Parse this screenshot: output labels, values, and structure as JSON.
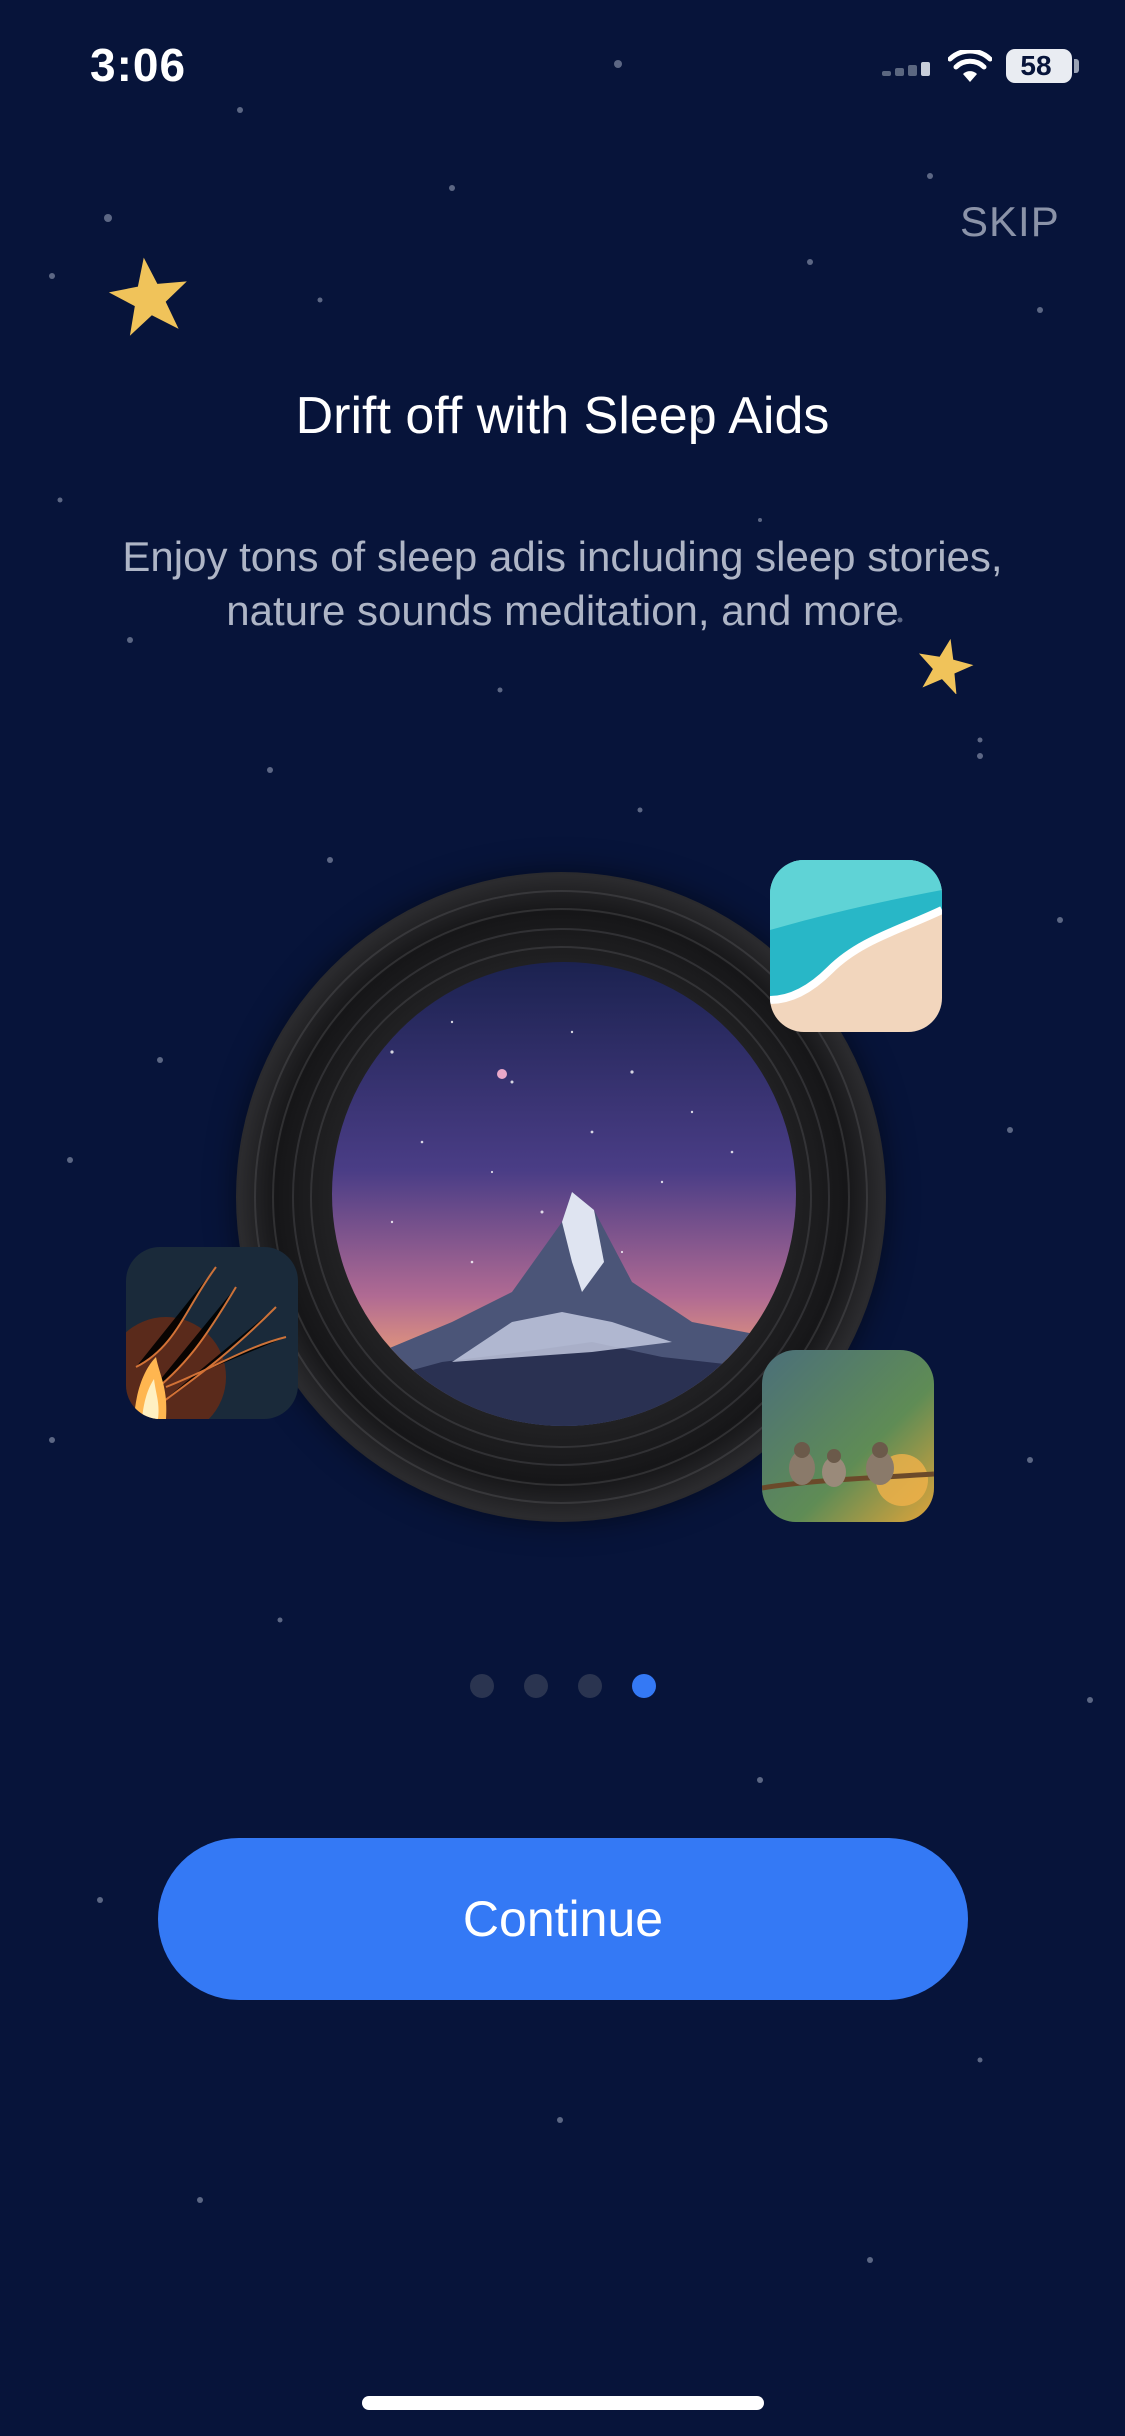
{
  "status_bar": {
    "time": "3:06",
    "battery": "58"
  },
  "onboarding": {
    "skip_label": "SKIP",
    "title": "Drift off with Sleep Aids",
    "subtitle_line1": "Enjoy tons of sleep adis including sleep stories,",
    "subtitle_line2": "nature sounds meditation, and more",
    "continue_label": "Continue",
    "pagination": {
      "total": 4,
      "active_index": 3
    }
  },
  "colors": {
    "background": "#07143a",
    "accent": "#3479f5",
    "star": "#f0c35a",
    "dot_inactive": "#2a3450",
    "subtitle": "#aeb5c6",
    "skip": "#8b93a8"
  },
  "icons": [
    "star-icon",
    "wifi-icon",
    "battery-icon",
    "signal-icon"
  ],
  "images": [
    "mountain-night-sky-image",
    "beach-wave-image",
    "campfire-image",
    "birds-on-branch-image"
  ]
}
